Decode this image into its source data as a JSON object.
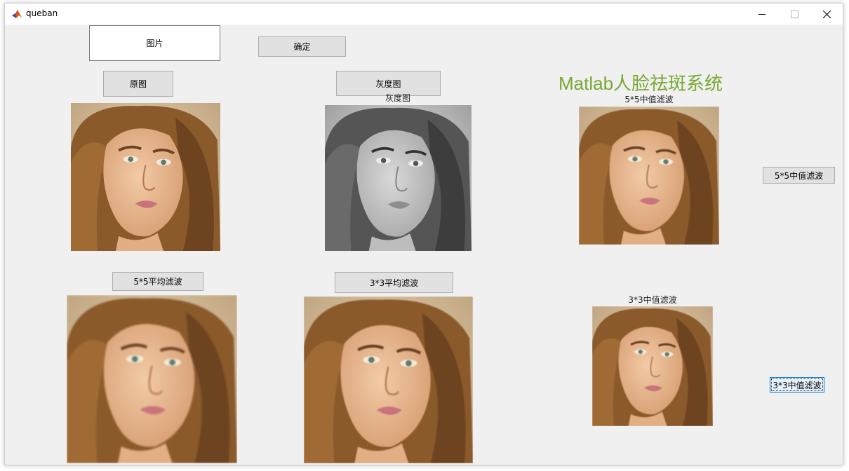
{
  "window": {
    "title": "queban"
  },
  "controls": {
    "image_box_label": "图片",
    "confirm_label": "确定",
    "original_label": "原图",
    "gray_label": "灰度图",
    "median5_label": "5*5中值滤波",
    "median3_label": "3*3中值滤波",
    "mean5_label": "5*5平均滤波",
    "mean3_label": "3*3平均滤波"
  },
  "heading": "Matlab人脸祛斑系统",
  "axes_titles": {
    "gray": "灰度图",
    "median5": "5*5中值滤波",
    "median3": "3*3中值滤波"
  }
}
